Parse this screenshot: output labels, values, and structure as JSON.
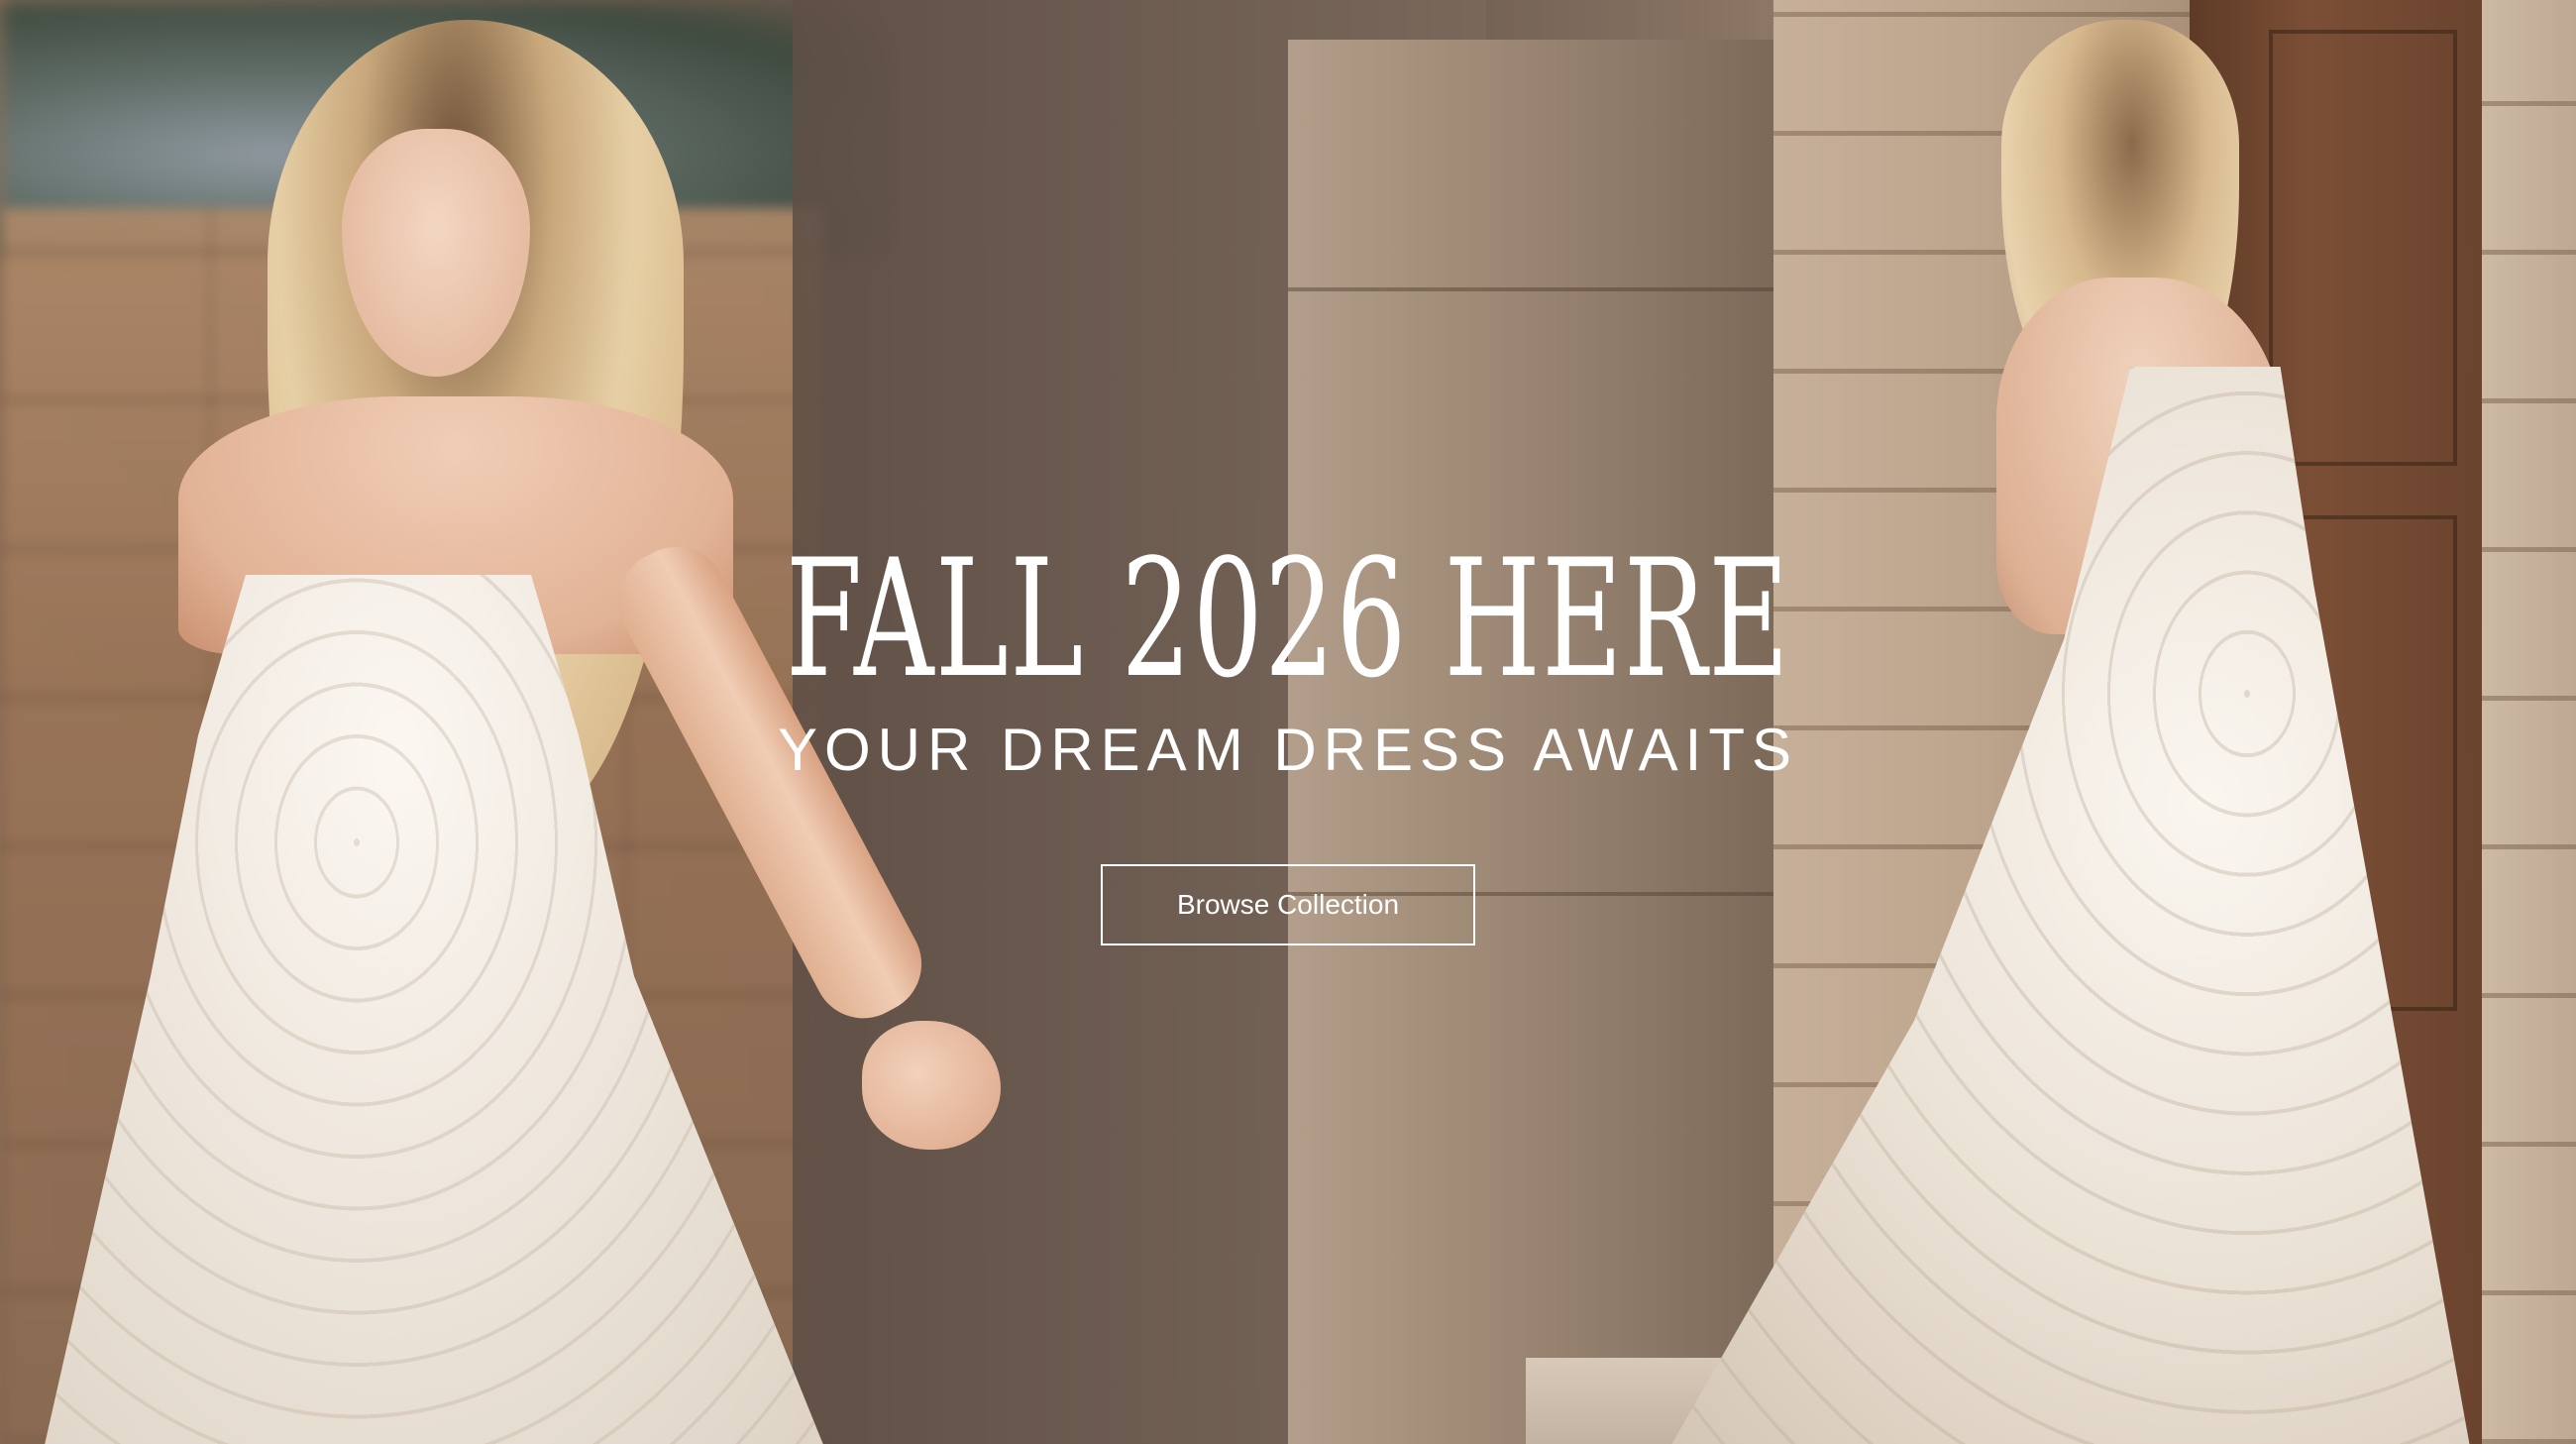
{
  "hero": {
    "headline": "FALL 2026 HERE",
    "subheadline": "YOUR DREAM DRESS AWAITS",
    "cta_label": "Browse Collection"
  }
}
